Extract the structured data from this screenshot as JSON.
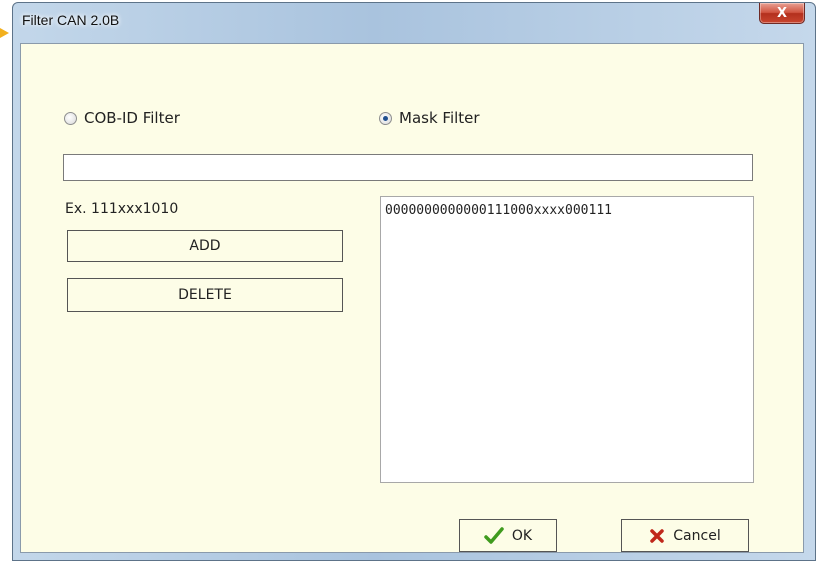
{
  "window": {
    "title": "Filter CAN 2.0B",
    "close_glyph": "X"
  },
  "filter_type": {
    "cob_id_label": "COB-ID Filter",
    "mask_label": "Mask Filter",
    "selected": "mask"
  },
  "filter_input": {
    "value": ""
  },
  "example_text": "Ex. 111xxx1010",
  "buttons": {
    "add": "ADD",
    "delete": "DELETE",
    "ok": "OK",
    "cancel": "Cancel"
  },
  "filter_list": {
    "items": [
      "0000000000000111000xxxx000111"
    ]
  },
  "icons": {
    "ok": "checkmark-icon",
    "cancel": "red-x-icon",
    "close": "close-icon"
  },
  "colors": {
    "client_background": "#fdfde7",
    "ok_check": "#3f9b1e",
    "cancel_x": "#c0281b",
    "close_button": "#c9452f"
  }
}
